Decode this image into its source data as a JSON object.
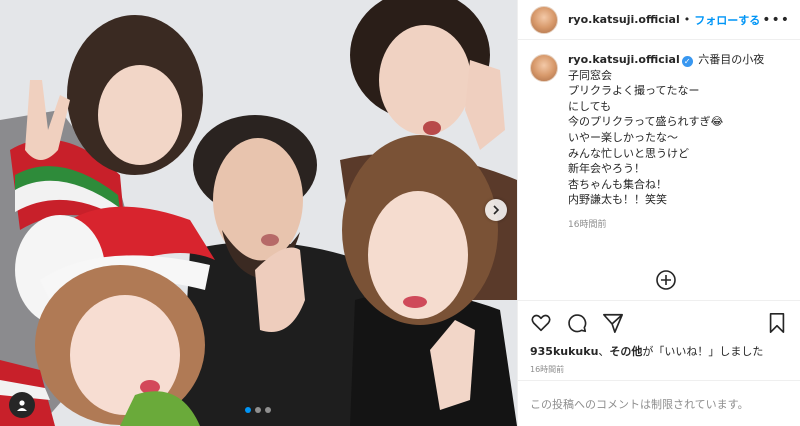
{
  "post": {
    "username": "ryo.katsuji.official",
    "separator": "•",
    "follow_label": "フォローする",
    "more_label": "•••",
    "caption_lines": [
      "六番目の小夜子同窓会",
      "プリクラよく撮ってたなー",
      "にしても",
      "今のプリクラって盛られすぎ😂",
      "いやー楽しかったな〜",
      "みんな忙しいと思うけど",
      "新年会やろう！",
      "杏ちゃんも集合ね！",
      "内野謙太も！！笑笑"
    ],
    "caption_time": "16時間前",
    "likes_user": "935kukuku",
    "likes_mid": "、",
    "likes_other": "その他",
    "likes_suffix": "が「いいね！」しました",
    "post_time": "16時間前",
    "comment_placeholder": "この投稿へのコメントは制限されています。"
  },
  "carousel": {
    "slide_count": 3,
    "active_index": 0
  },
  "colors": {
    "accent": "#0095f6",
    "text": "#262626",
    "muted": "#8e8e8e",
    "border": "#efefef"
  },
  "icons": {
    "next": "chevron-right-icon",
    "tag": "user-tag-icon",
    "load_more": "plus-circle-icon",
    "like": "heart-icon",
    "comment": "comment-icon",
    "share": "share-icon",
    "save": "bookmark-icon",
    "verified": "verified-badge-icon"
  }
}
